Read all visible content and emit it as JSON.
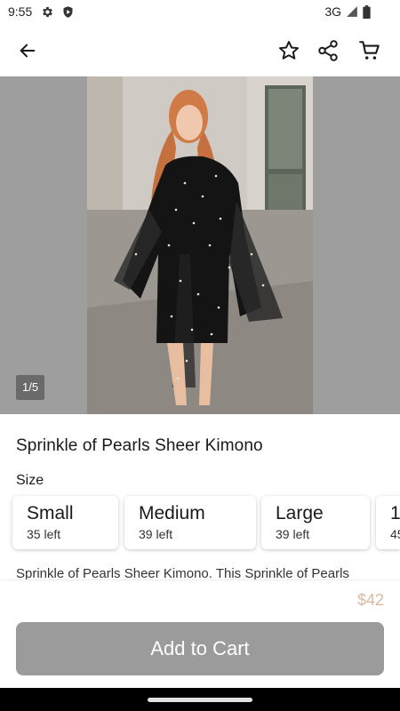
{
  "status_bar": {
    "time": "9:55",
    "network": "3G",
    "icons": [
      "gear-icon",
      "shield-play-icon",
      "signal-icon",
      "battery-icon"
    ]
  },
  "app_bar": {
    "icons": [
      "arrow-left-icon",
      "star-outline-icon",
      "share-icon",
      "cart-icon"
    ]
  },
  "gallery": {
    "counter": "1/5"
  },
  "product": {
    "title": "Sprinkle of Pearls Sheer Kimono",
    "size_label": "Size",
    "sizes": [
      {
        "name": "Small",
        "stock": "35 left"
      },
      {
        "name": "Medium",
        "stock": "39 left"
      },
      {
        "name": "Large",
        "stock": "39 left"
      },
      {
        "name": "1",
        "stock": "45"
      }
    ],
    "description": "Sprinkle of Pearls Sheer Kimono. This Sprinkle of Pearls"
  },
  "purchase": {
    "price": "$42",
    "add_to_cart_label": "Add to Cart"
  },
  "colors": {
    "price_accent": "#d9b9a0",
    "button_disabled": "#9b9b9b",
    "overlay_gray": "#9e9e9e"
  }
}
